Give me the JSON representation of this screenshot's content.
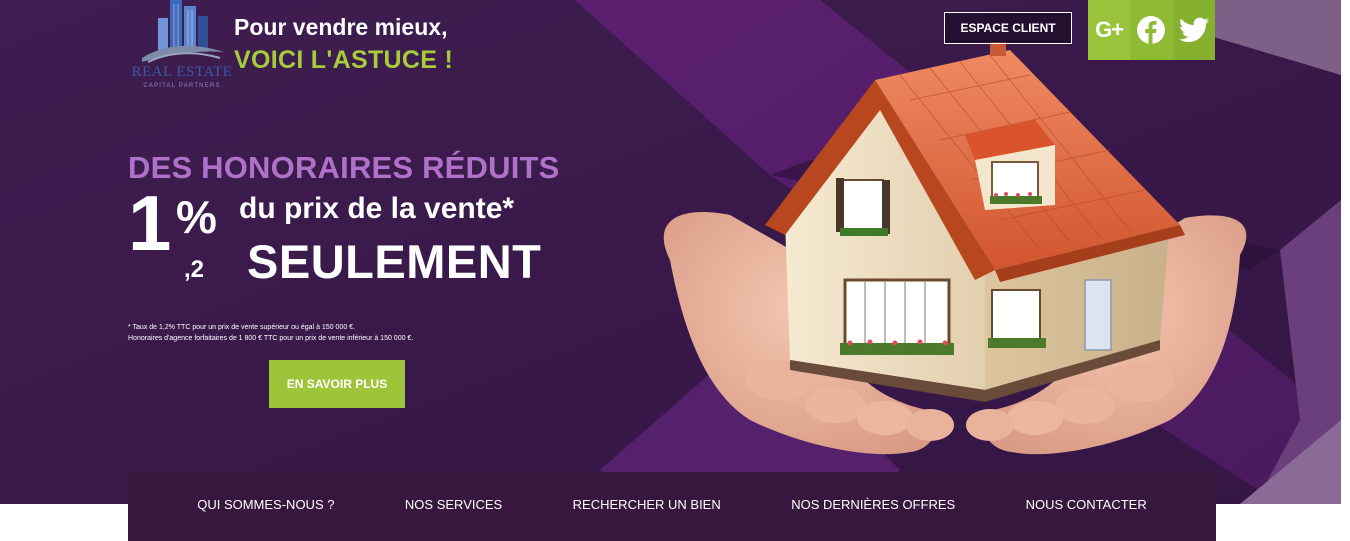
{
  "brand": {
    "logo_word": "REAL ESTATE",
    "logo_subtitle": "CAPITAL PARTNERS"
  },
  "tagline": {
    "line1": "Pour vendre mieux,",
    "line2": "VOICI L'ASTUCE !"
  },
  "header": {
    "espace_client_label": "ESPACE CLIENT",
    "social": [
      {
        "icon": "google-plus-icon",
        "label": "G+"
      },
      {
        "icon": "facebook-icon",
        "label": ""
      },
      {
        "icon": "twitter-icon",
        "label": ""
      }
    ]
  },
  "promo": {
    "headline": "DES HONORAIRES RÉDUITS",
    "rate_integer": "1",
    "rate_symbol": "%",
    "rate_decimal": ",2",
    "price_text": "du prix de la vente*",
    "emphasis": "SEULEMENT",
    "footnote_1": "* Taux de 1,2% TTC pour un prix de vente supérieur ou égal à 150 000 €.",
    "footnote_2": "Honoraires d'agence forfaitaires de 1 800 € TTC pour un prix de vente inférieur à 150 000 €.",
    "cta_label": "EN SAVOIR PLUS"
  },
  "nav": {
    "items": [
      "QUI SOMMES-NOUS ?",
      "NOS SERVICES",
      "RECHERCHER UN BIEN",
      "NOS DERNIÈRES OFFRES",
      "NOUS CONTACTER"
    ]
  },
  "colors": {
    "hero_dark": "#3d1c4f",
    "hero_mid": "#5a2272",
    "hero_light": "#7b5a8a",
    "accent_green": "#9ec43a",
    "headline_purple": "#b071c8",
    "nav_bg": "#38173f"
  }
}
